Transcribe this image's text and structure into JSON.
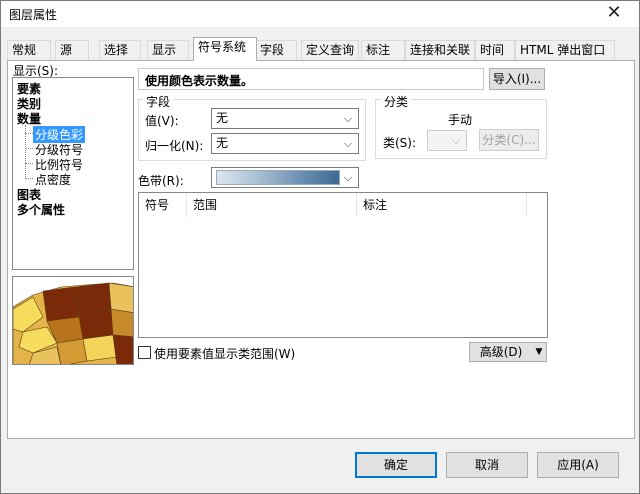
{
  "window": {
    "title": "图层属性"
  },
  "tabs": [
    "常规",
    "源",
    "选择",
    "显示",
    "符号系统",
    "字段",
    "定义查询",
    "标注",
    "连接和关联",
    "时间",
    "HTML 弹出窗口"
  ],
  "active_tab": "符号系统",
  "left": {
    "show_label": "显示(S):",
    "tree": {
      "features": "要素",
      "categories": "类别",
      "quantities": "数量",
      "graduated_colors": "分级色彩",
      "graduated_symbols": "分级符号",
      "proportional_symbols": "比例符号",
      "dot_density": "点密度",
      "charts": "图表",
      "multiple_attributes": "多个属性"
    }
  },
  "main": {
    "description": "使用颜色表示数量。",
    "import_button": "导入(I)...",
    "fields": {
      "legend": "字段",
      "value_label": "值(V):",
      "value": "无",
      "normalization_label": "归一化(N):",
      "normalization": "无"
    },
    "classification": {
      "legend": "分类",
      "method": "手动",
      "classes_label": "类(S):",
      "classes_value": "",
      "classify_button": "分类(C)..."
    },
    "color_ramp_label": "色带(R):",
    "table": {
      "columns": [
        "符号",
        "范围",
        "标注"
      ]
    },
    "show_feature_values_label": "使用要素值显示类范围(W)",
    "show_feature_values_checked": false,
    "advanced_button": "高级(D)"
  },
  "footer": {
    "ok": "确定",
    "cancel": "取消",
    "apply": "应用(A)"
  },
  "colors": {
    "accent": "#0078d7",
    "selection": "#3399ff"
  }
}
